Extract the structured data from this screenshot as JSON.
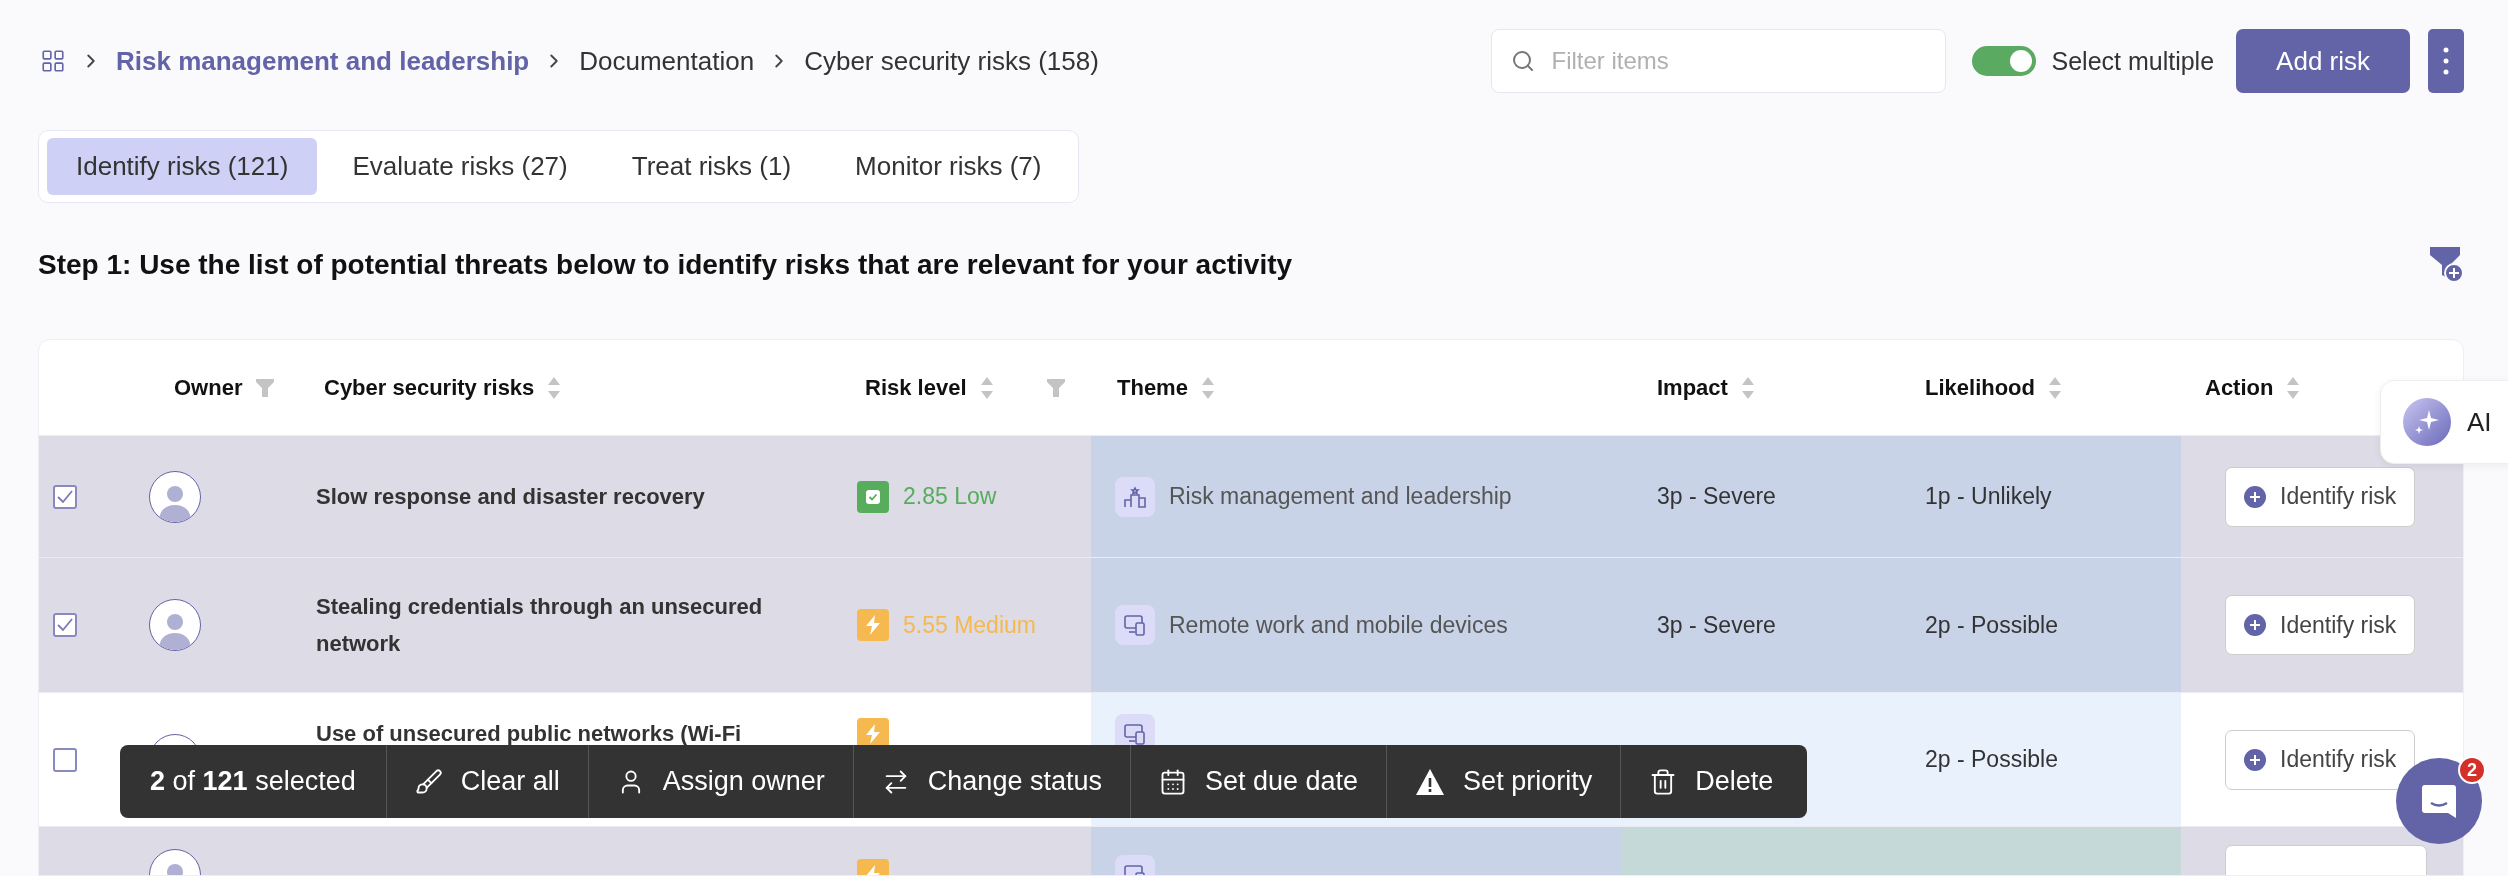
{
  "breadcrumb": [
    {
      "label": "Risk management and leadership",
      "link": true
    },
    {
      "label": "Documentation",
      "link": false
    },
    {
      "label": "Cyber security risks (158)",
      "link": false
    }
  ],
  "search": {
    "placeholder": "Filter items"
  },
  "select_multiple": {
    "label": "Select multiple",
    "on": true
  },
  "add_button": "Add risk",
  "tabs": [
    {
      "label": "Identify risks (121)",
      "selected": true
    },
    {
      "label": "Evaluate risks (27)",
      "selected": false
    },
    {
      "label": "Treat risks (1)",
      "selected": false
    },
    {
      "label": "Monitor risks (7)",
      "selected": false
    }
  ],
  "step_text": "Step 1: Use the list of potential threats below to identify risks that are relevant for your activity",
  "table": {
    "columns": [
      {
        "label": "Owner",
        "sortable": false,
        "filterable": true
      },
      {
        "label": "Cyber security risks",
        "sortable": true,
        "filterable": false
      },
      {
        "label": "Risk level",
        "sortable": true,
        "filterable": true
      },
      {
        "label": "Theme",
        "sortable": true,
        "filterable": false
      },
      {
        "label": "Impact",
        "sortable": true,
        "filterable": false
      },
      {
        "label": "Likelihood",
        "sortable": true,
        "filterable": false
      },
      {
        "label": "Action",
        "sortable": true,
        "filterable": false
      }
    ],
    "rows": [
      {
        "selected": true,
        "highlighted": true,
        "risk": "Slow response and disaster recovery",
        "risk_level": {
          "kind": "low",
          "text": "2.85 Low"
        },
        "theme": {
          "kind": "leadership",
          "text": "Risk management and leadership"
        },
        "impact": "3p - Severe",
        "likelihood": "1p - Unlikely",
        "action": "Identify risk"
      },
      {
        "selected": true,
        "highlighted": true,
        "risk": "Stealing credentials through an unsecured network",
        "risk_level": {
          "kind": "medium",
          "text": "5.55 Medium"
        },
        "theme": {
          "kind": "devices",
          "text": "Remote work and mobile devices"
        },
        "impact": "3p - Severe",
        "likelihood": "2p - Possible",
        "action": "Identify risk"
      },
      {
        "selected": false,
        "highlighted": false,
        "risk": "Use of unsecured public networks (Wi-Fi",
        "risk_level": {
          "kind": "medium"
        },
        "theme": {
          "kind": "devices"
        },
        "likelihood": "2p - Possible",
        "action": "Identify risk"
      },
      {
        "highlighted": true,
        "risk_level": {
          "kind": "medium"
        },
        "theme": {
          "kind": "devices"
        }
      }
    ]
  },
  "bulk_bar": {
    "summary": "**2** of **121** selected",
    "actions": [
      {
        "kind": "clear",
        "label": "Clear all"
      },
      {
        "kind": "owner",
        "label": "Assign owner"
      },
      {
        "kind": "status",
        "label": "Change status"
      },
      {
        "kind": "date",
        "label": "Set due date"
      },
      {
        "kind": "priority",
        "label": "Set priority"
      },
      {
        "kind": "delete",
        "label": "Delete"
      }
    ]
  },
  "ai_button": "AI",
  "chat": {
    "badge": "2"
  }
}
